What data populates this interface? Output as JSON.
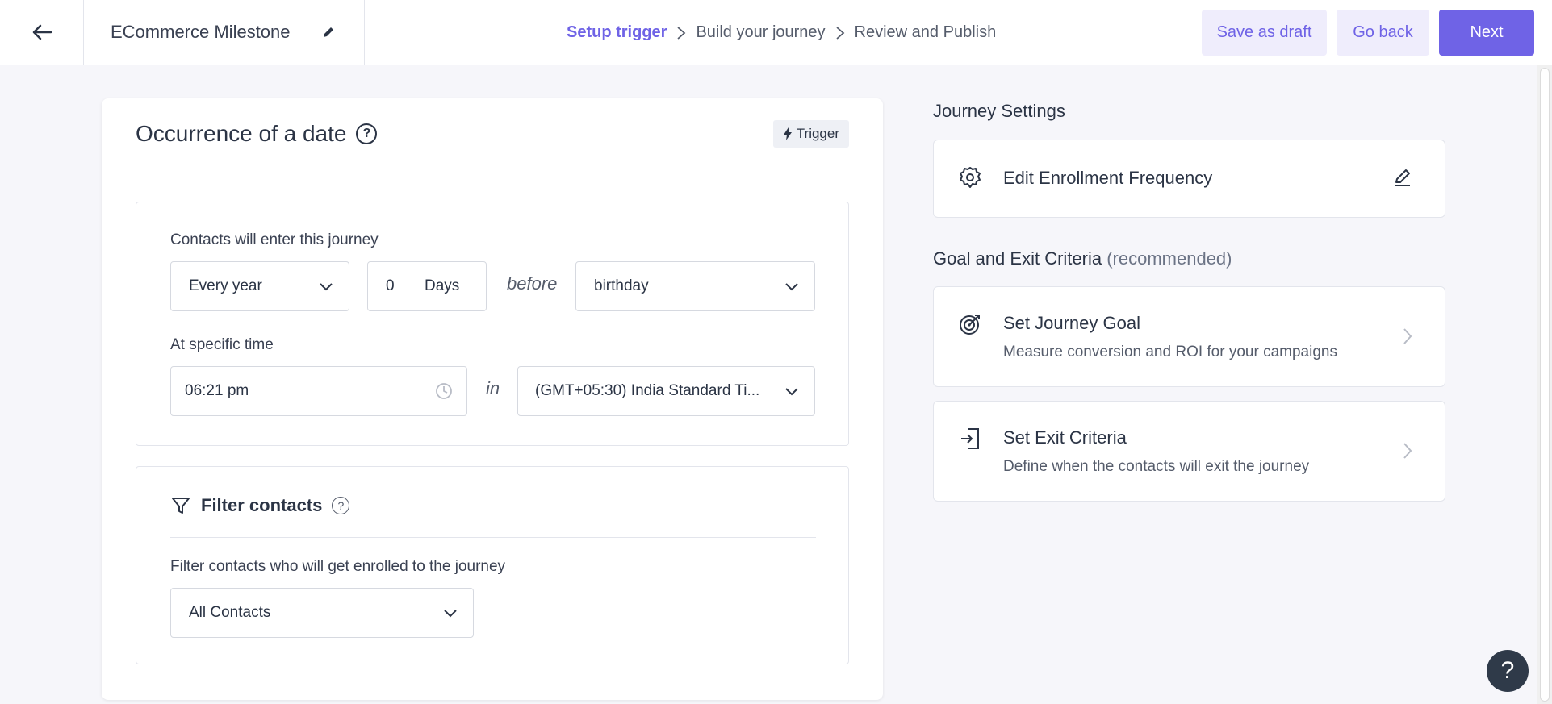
{
  "header": {
    "journey_title": "ECommerce Milestone",
    "steps": [
      "Setup trigger",
      "Build your journey",
      "Review and Publish"
    ],
    "save_draft_label": "Save as draft",
    "go_back_label": "Go back",
    "next_label": "Next"
  },
  "trigger_card": {
    "title": "Occurrence of a date",
    "badge": "Trigger",
    "entry_label": "Contacts will enter this journey",
    "frequency_value": "Every year",
    "days_value": "0",
    "days_unit": "Days",
    "before_word": "before",
    "date_field_value": "birthday",
    "time_label": "At specific time",
    "time_value": "06:21 pm",
    "in_word": "in",
    "timezone_value": "(GMT+05:30) India Standard Ti...",
    "filter_title": "Filter contacts",
    "filter_desc": "Filter contacts who will get enrolled to the journey",
    "filter_value": "All Contacts"
  },
  "right_panel": {
    "settings_heading": "Journey Settings",
    "enrollment_label": "Edit Enrollment Frequency",
    "goal_heading": "Goal and Exit Criteria",
    "goal_heading_note": "(recommended)",
    "goal_title": "Set Journey Goal",
    "goal_desc": "Measure conversion and ROI for your campaigns",
    "exit_title": "Set Exit Criteria",
    "exit_desc": "Define when the contacts will exit the journey"
  },
  "help_fab_label": "?",
  "colors": {
    "accent": "#6f63e6",
    "accent_light": "#efedfc",
    "background": "#f6f6fa",
    "text": "#2b3445"
  }
}
